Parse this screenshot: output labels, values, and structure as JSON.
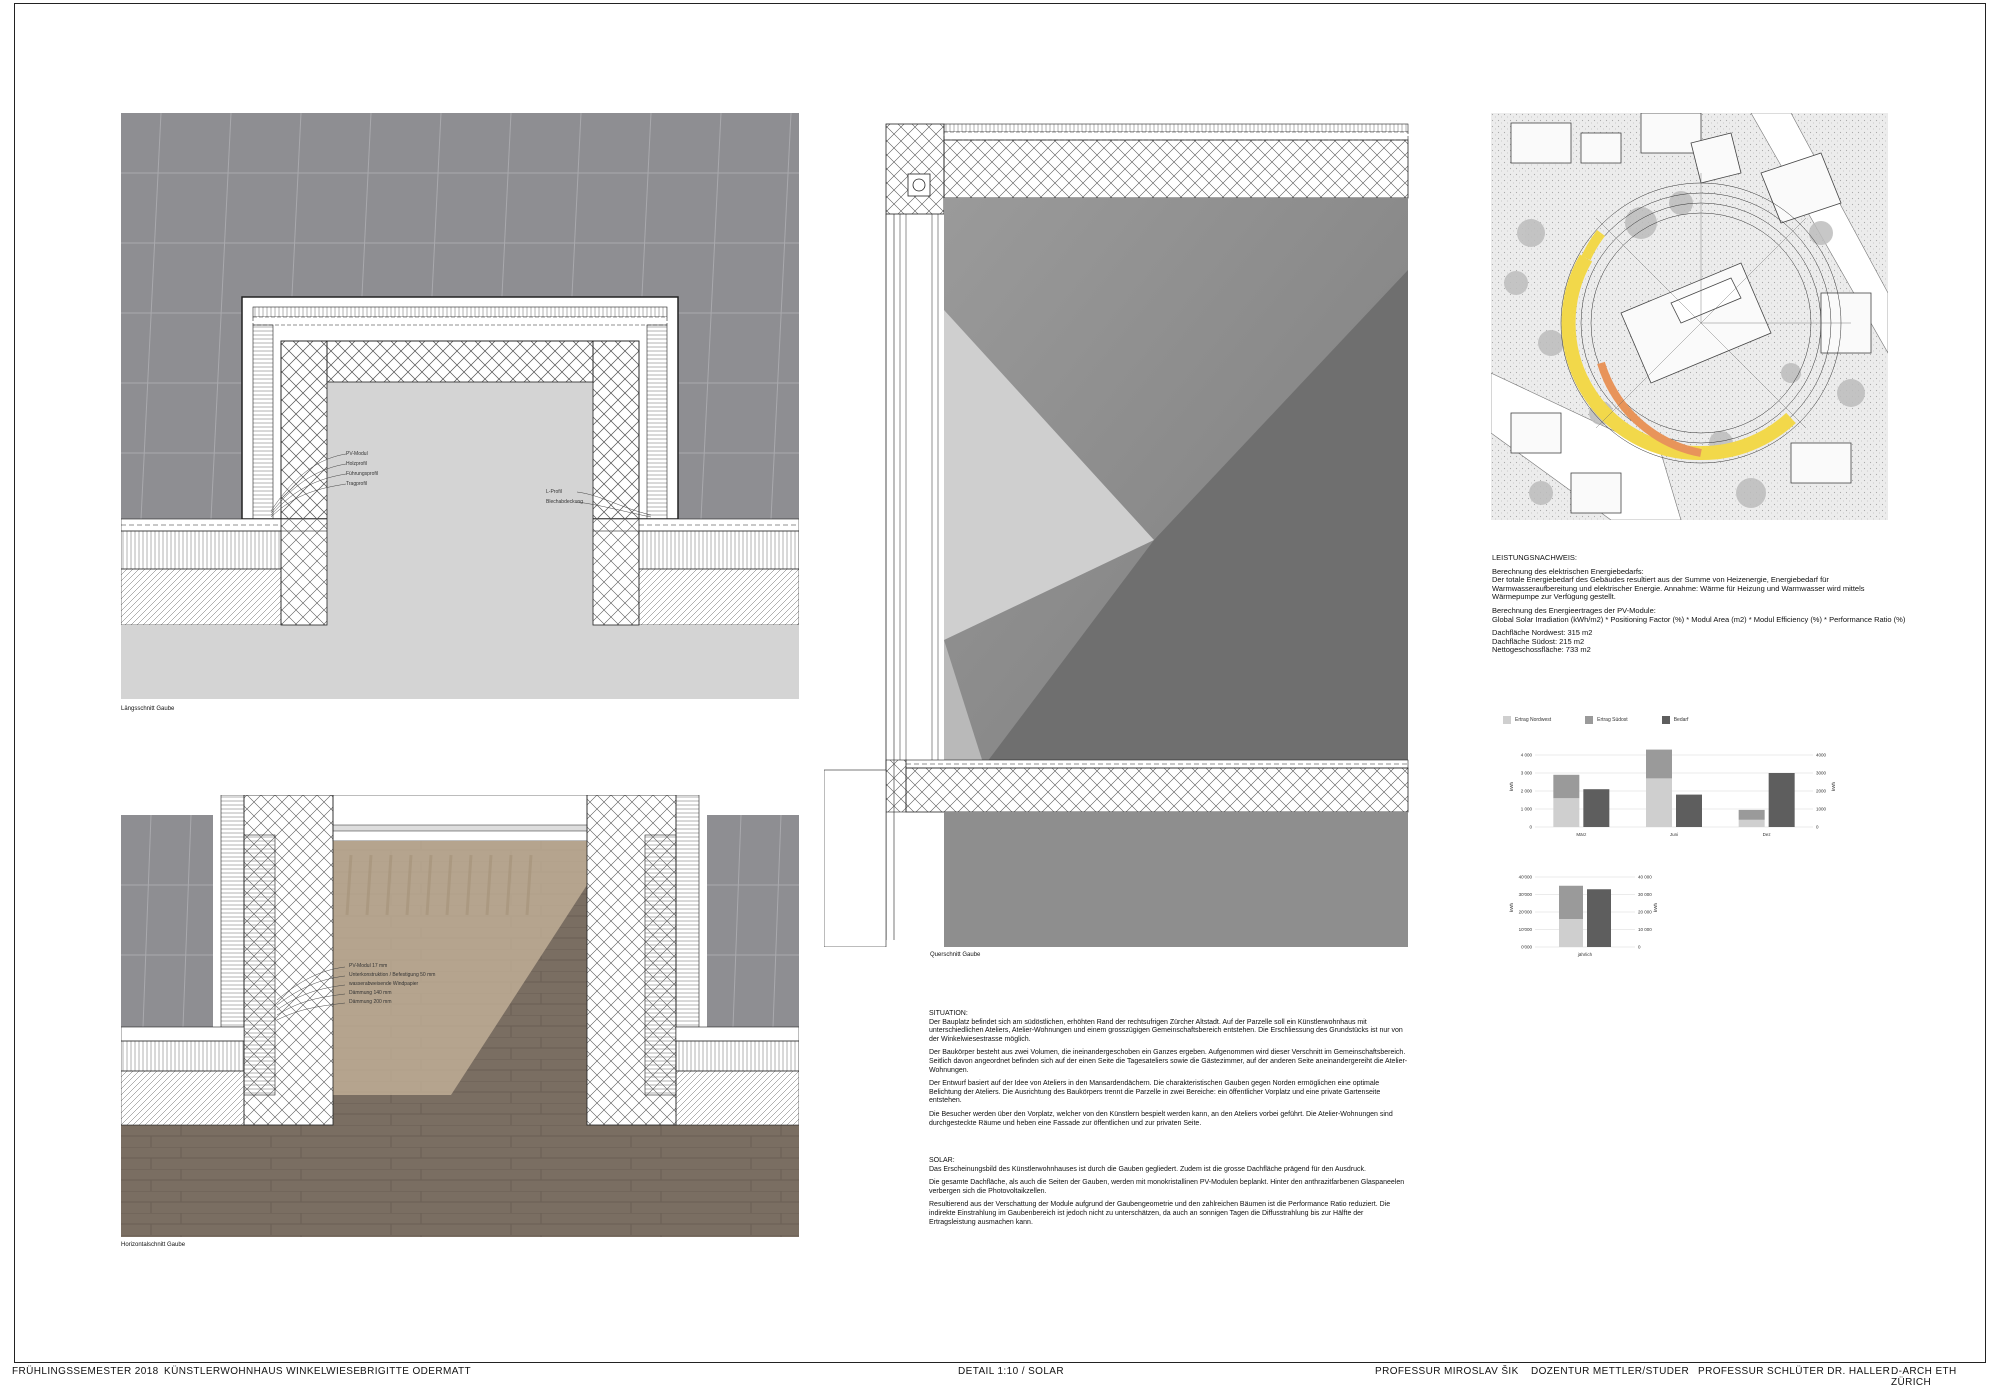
{
  "captions": {
    "plan_top": "Längsschnitt Gaube",
    "plan_bottom": "Horizontalschnitt Gaube",
    "section": "Querschnitt Gaube"
  },
  "annotations_top_left": [
    "PV-Modul",
    "Holzprofil",
    "Führungsprofil",
    "Tragprofil"
  ],
  "annotations_top_right": [
    "L-Profil",
    "Blechabdeckung"
  ],
  "annotations_bottom": [
    "PV-Modul 17 mm",
    "Unterkonstruktion / Befestigung 50 mm",
    "wasserabweisende Windpapier",
    "Dämmung 140 mm",
    "Dämmung 200 mm"
  ],
  "performance": {
    "title": "LEISTUNGSNACHWEIS:",
    "lines1": [
      "Berechnung des elektrischen Energiebedarfs:",
      "Der totale Energiebedarf des Gebäudes resultiert aus der Summe von Heizenergie, Energiebedarf für",
      "Warmwasseraufbereitung und elektrischer Energie. Annahme: Wärme für Heizung und Warmwasser wird mittels",
      "Wärmepumpe zur Verfügung gestellt."
    ],
    "lines2": [
      "Berechnung des Energieertrages der PV-Module:",
      "Global Solar Irradiation (kWh/m2) * Positioning Factor (%) * Modul Area (m2) * Modul Efficiency (%) * Performance Ratio (%)"
    ],
    "lines3": [
      "Dachfläche Nordwest: 315 m2",
      "Dachfläche Südost: 215 m2",
      "Nettogeschossfläche: 733 m2"
    ]
  },
  "legend": [
    "Ertrag Nordwest",
    "Ertrag Südost",
    "Bedarf"
  ],
  "colors": {
    "roof_gray": "#8c8c90",
    "concrete": "#cfcfcf",
    "legend_light": "#cfcfcf",
    "legend_mid": "#9a9a9a",
    "legend_dark": "#5e5e5e",
    "solar_yellow": "#f2d84a",
    "solar_orange": "#e8945a"
  },
  "chart_data": [
    {
      "type": "bar",
      "categories": [
        "März",
        "Juni",
        "Dez"
      ],
      "series": [
        {
          "name": "Ertrag Nordwest",
          "values": [
            1600,
            2700,
            400
          ]
        },
        {
          "name": "Ertrag Südost",
          "values": [
            1300,
            1600,
            550
          ]
        },
        {
          "name": "Bedarf",
          "values": [
            2100,
            1800,
            3000
          ]
        }
      ],
      "stacked_pairs": [
        [
          "Ertrag Nordwest",
          "Ertrag Südost"
        ]
      ],
      "ylim": [
        0,
        4000
      ],
      "yticks": [
        "0",
        "1 000",
        "2 000",
        "3 000",
        "4 000"
      ],
      "y2ticks": [
        "0",
        "1000",
        "2000",
        "3000",
        "4000"
      ],
      "ylabel": "kWh",
      "y2label": "kWh"
    },
    {
      "type": "bar",
      "categories": [
        "jährlich"
      ],
      "series": [
        {
          "name": "Ertrag Nordwest",
          "values": [
            16000
          ]
        },
        {
          "name": "Ertrag Südost",
          "values": [
            19000
          ]
        },
        {
          "name": "Bedarf",
          "values": [
            33000
          ]
        }
      ],
      "stacked_pairs": [
        [
          "Ertrag Nordwest",
          "Ertrag Südost"
        ]
      ],
      "ylim": [
        0,
        40000
      ],
      "yticks": [
        "0'000",
        "10'000",
        "20'000",
        "30'000",
        "40'000"
      ],
      "y2ticks": [
        "0",
        "10 000",
        "20 000",
        "30 000",
        "40 000"
      ],
      "ylabel": "kWh",
      "y2label": "kWh"
    }
  ],
  "situation": {
    "title": "SITUATION:",
    "paragraphs": [
      "Der Bauplatz befindet sich am südöstlichen, erhöhten Rand der rechtsufrigen Zürcher Altstadt. Auf der Parzelle soll ein Künstlerwohnhaus mit unterschiedlichen Ateliers, Atelier-Wohnungen und einem grosszügigen Gemeinschaftsbereich entstehen. Die Erschliessung des Grundstücks ist nur von der Winkelwiesestrasse möglich.",
      "Der Baukörper besteht aus zwei Volumen, die ineinandergeschoben ein Ganzes ergeben. Aufgenommen wird dieser Verschnitt im Gemeinschaftsbereich. Seitlich davon angeordnet befinden sich auf der einen Seite die Tagesateliers sowie die Gästezimmer, auf der anderen Seite aneinandergereiht die Atelier-Wohnungen.",
      "Der Entwurf basiert auf der Idee von Ateliers in den Mansardendächern. Die charakteristischen Gauben gegen Norden ermöglichen eine optimale Belichtung der Ateliers. Die Ausrichtung des Baukörpers trennt die Parzelle in zwei Bereiche: ein öffentlicher Vorplatz und eine private Gartenseite entstehen.",
      "Die Besucher werden über den Vorplatz, welcher von den Künstlern bespielt werden kann, an den Ateliers vorbei geführt. Die Atelier-Wohnungen sind durchgesteckte Räume und heben eine Fassade zur öffentlichen und zur privaten Seite."
    ]
  },
  "solar": {
    "title": "SOLAR:",
    "paragraphs": [
      "Das Erscheinungsbild des Künstlerwohnhauses ist durch die Gauben gegliedert. Zudem ist die grosse Dachfläche prägend für den Ausdruck.",
      "Die gesamte Dachfläche, als auch die Seiten der Gauben, werden mit monokristallinen PV-Modulen beplankt. Hinter den anthrazitfarbenen Glaspaneelen verbergen sich die Photovoltaikzellen.",
      "Resultierend aus der Verschattung der Module aufgrund der Gaubengeometrie und den zahlreichen Bäumen ist die Performance Ratio reduziert. Die indirekte Einstrahlung im Gaubenbereich ist jedoch nicht zu unterschätzen, da auch an sonnigen Tagen die Diffusstrahlung bis zur Hälfte der Ertragsleistung ausmachen kann."
    ]
  },
  "footer": {
    "semester": "FRÜHLINGSSEMESTER 2018",
    "project": "KÜNSTLERWOHNHAUS WINKELWIESE",
    "author": "BRIGITTE ODERMATT",
    "detail": "DETAIL 1:10 / SOLAR",
    "prof1": "PROFESSUR MIROSLAV ŠIK",
    "doz": "DOZENTUR METTLER/STUDER",
    "prof2": "PROFESSUR SCHLÜTER DR. HALLER",
    "dept": "D-ARCH ETH ZÜRICH"
  }
}
